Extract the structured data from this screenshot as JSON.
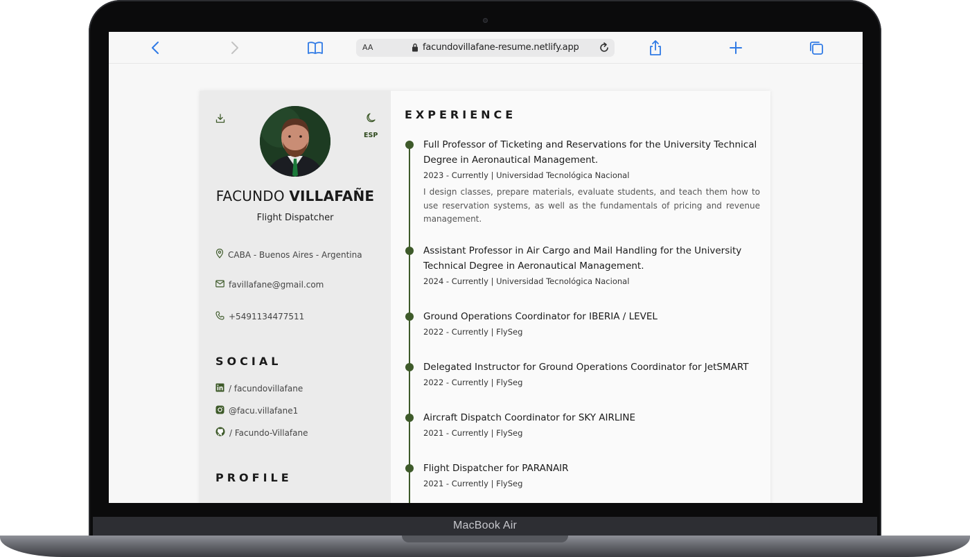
{
  "device": {
    "label": "MacBook Air"
  },
  "browser": {
    "aa_label": "AA",
    "url": "facundovillafane-resume.netlify.app"
  },
  "profile": {
    "first_name": "FACUNDO",
    "last_name": "VILLAFAÑE",
    "role": "Flight Dispatcher",
    "lang_toggle": "ESP",
    "location": "CABA - Buenos Aires - Argentina",
    "email": "favillafane@gmail.com",
    "phone": "+5491134477511"
  },
  "social": {
    "title": "SOCIAL",
    "linkedin": "/ facundovillafane",
    "instagram": "@facu.villafane1",
    "github": "/ Facundo-Villafane"
  },
  "profile_section": {
    "title": "PROFILE"
  },
  "experience": {
    "title": "EXPERIENCE",
    "items": [
      {
        "title": "Full Professor of Ticketing and Reservations for the University Technical Degree in Aeronautical Management.",
        "meta": "2023 - Currently | Universidad Tecnológica Nacional",
        "desc": "I design classes, prepare materials, evaluate students, and teach them how to use reservation systems, as well as the fundamentals of pricing and revenue management."
      },
      {
        "title": "Assistant Professor in Air Cargo and Mail Handling for the University Technical Degree in Aeronautical Management.",
        "meta": "2024 - Currently | Universidad Tecnológica Nacional"
      },
      {
        "title": "Ground Operations Coordinator for IBERIA / LEVEL",
        "meta": "2022 - Currently | FlySeg"
      },
      {
        "title": "Delegated Instructor for Ground Operations Coordinator for JetSMART",
        "meta": "2022 - Currently | FlySeg"
      },
      {
        "title": "Aircraft Dispatch Coordinator for SKY AIRLINE",
        "meta": "2021 - Currently | FlySeg"
      },
      {
        "title": "Flight Dispatcher for PARANAIR",
        "meta": "2021 - Currently | FlySeg"
      }
    ]
  },
  "colors": {
    "accent": "#3e5a2a",
    "ios_blue": "#2f7ae5"
  }
}
